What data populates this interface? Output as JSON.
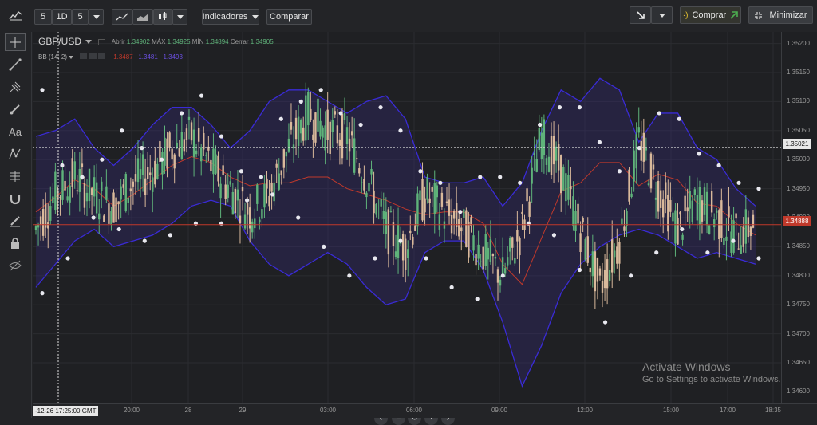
{
  "toolbar": {
    "interval_count": "5",
    "interval_unit": "1D",
    "interval_step": "5",
    "indicators_label": "Indicadores",
    "compare_label": "Comparar",
    "buy_label": "Comprar",
    "minimize_label": "Minimizar"
  },
  "sidebar": {
    "text_tool_label": "Aa"
  },
  "legend": {
    "symbol": "GBP/USD",
    "open_label": "Abrir",
    "open_value": "1.34902",
    "high_label": "MÁX",
    "high_value": "1.34925",
    "low_label": "MÍN",
    "low_value": "1.34894",
    "close_label": "Cerrar",
    "close_value": "1.34905",
    "bb_label": "BB (14, 2)",
    "bb_mid": "1.3487",
    "bb_upper": "1.3481",
    "bb_lower": "1.3493"
  },
  "price_axis": {
    "ticks": [
      "1.35200",
      "1.35150",
      "1.35100",
      "1.35050",
      "1.35000",
      "1.34950",
      "1.34900",
      "1.34850",
      "1.34800",
      "1.34750",
      "1.34700",
      "1.34650",
      "1.34600"
    ],
    "crosshair_price": "1.35021",
    "last_price": "1.34888"
  },
  "time_axis": {
    "crosshair_time": "-12-26 17:25:00 GMT",
    "ticks": [
      "20:00",
      "28",
      "29",
      "03:00",
      "06:00",
      "09:00",
      "12:00",
      "15:00",
      "17:00",
      "18:35"
    ]
  },
  "watermark": {
    "title": "Activate Windows",
    "subtitle": "Go to Settings to activate Windows."
  },
  "colors": {
    "up": "#5fb37a",
    "down": "#d9b99b",
    "band": "#3b2a8c",
    "mid": "#c0392b",
    "last_price": "#c0392b"
  },
  "chart_data": {
    "type": "candlestick",
    "ylim": [
      1.3458,
      1.3522
    ],
    "upper_band": [
      1.3504,
      1.3505,
      1.3507,
      1.3502,
      1.3499,
      1.3502,
      1.3506,
      1.3509,
      1.3509,
      1.3506,
      1.3502,
      1.3505,
      1.351,
      1.3512,
      1.3512,
      1.351,
      1.3508,
      1.351,
      1.3511,
      1.3507,
      1.3497,
      1.3496,
      1.3496,
      1.3497,
      1.3492,
      1.3496,
      1.3505,
      1.3512,
      1.351,
      1.3514,
      1.3512,
      1.3503,
      1.3508,
      1.3508,
      1.3502,
      1.35,
      1.3495,
      1.3492
    ],
    "lower_band": [
      1.3478,
      1.3482,
      1.3486,
      1.3488,
      1.3485,
      1.3486,
      1.3487,
      1.3489,
      1.3492,
      1.3493,
      1.3492,
      1.3486,
      1.3482,
      1.348,
      1.3482,
      1.3484,
      1.3482,
      1.3478,
      1.3475,
      1.3476,
      1.3484,
      1.3486,
      1.3486,
      1.3481,
      1.3472,
      1.3461,
      1.3468,
      1.3477,
      1.3482,
      1.3485,
      1.3487,
      1.3488,
      1.3487,
      1.3485,
      1.3483,
      1.3484,
      1.3483,
      1.3482
    ],
    "close": [
      1.3488,
      1.3494,
      1.3497,
      1.3494,
      1.3492,
      1.3496,
      1.3498,
      1.3502,
      1.3504,
      1.3499,
      1.3495,
      1.3491,
      1.3494,
      1.3502,
      1.3508,
      1.3505,
      1.3504,
      1.3497,
      1.3488,
      1.3485,
      1.3494,
      1.3491,
      1.3488,
      1.3484,
      1.348,
      1.3488,
      1.3504,
      1.3498,
      1.3488,
      1.3478,
      1.3486,
      1.3503,
      1.3495,
      1.3488,
      1.3493,
      1.349,
      1.3487,
      1.3489
    ],
    "dots_upper": [
      1.3512,
      1.3499,
      1.3497,
      1.35,
      1.3505,
      1.3502,
      1.35,
      1.3508,
      1.3511,
      1.3504,
      1.3498,
      1.3497,
      1.3507,
      1.351,
      1.3512,
      1.3508,
      1.3506,
      1.3509,
      1.3505,
      1.3498,
      1.3496,
      1.3491,
      1.3497,
      1.3497,
      1.3496,
      1.3506,
      1.3509,
      1.3509,
      1.3503,
      1.3498,
      1.3502,
      1.3508,
      1.3507,
      1.3501,
      1.3499,
      1.3496,
      1.3495
    ],
    "dots_lower": [
      1.3477,
      1.3483,
      1.349,
      1.3488,
      1.3486,
      1.3487,
      1.3489,
      1.3489,
      1.3493,
      1.3494,
      1.349,
      1.3485,
      1.348,
      1.3483,
      1.3486,
      1.3483,
      1.3478,
      1.3476,
      1.348,
      1.3489,
      1.3487,
      1.3481,
      1.3472,
      1.348,
      1.3484,
      1.3488,
      1.3484,
      1.3486,
      1.3483
    ]
  }
}
